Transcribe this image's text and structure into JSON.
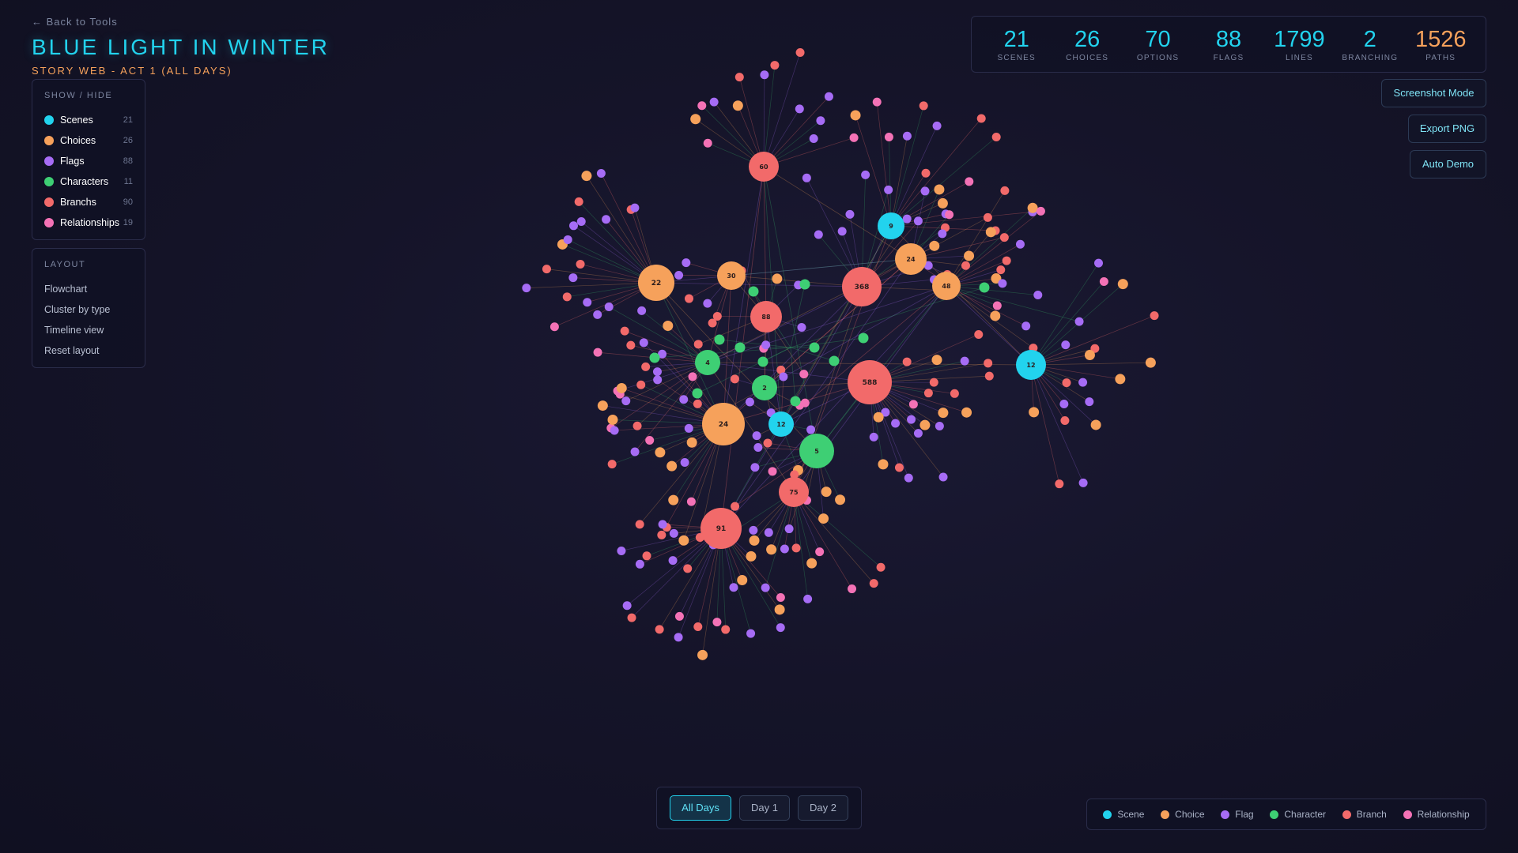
{
  "header": {
    "back_label": "← Back to Tools",
    "title": "BLUE LIGHT IN WINTER",
    "subtitle": "STORY WEB - ACT 1 (ALL DAYS)"
  },
  "colors": {
    "scene": "#22d3ee",
    "choice": "#f6a15b",
    "flag": "#a66cf5",
    "character": "#3ecf74",
    "branch": "#f26a6a",
    "relationship": "#f472b6"
  },
  "show_hide": {
    "heading": "SHOW / HIDE",
    "items": [
      {
        "label": "Scenes",
        "count": "21",
        "color": "#22d3ee"
      },
      {
        "label": "Choices",
        "count": "26",
        "color": "#f6a15b"
      },
      {
        "label": "Flags",
        "count": "88",
        "color": "#a66cf5"
      },
      {
        "label": "Characters",
        "count": "11",
        "color": "#3ecf74"
      },
      {
        "label": "Branchs",
        "count": "90",
        "color": "#f26a6a"
      },
      {
        "label": "Relationships",
        "count": "19",
        "color": "#f472b6"
      }
    ]
  },
  "layout": {
    "heading": "LAYOUT",
    "items": [
      "Flowchart",
      "Cluster by type",
      "Timeline view",
      "Reset layout"
    ]
  },
  "stats": [
    {
      "value": "21",
      "label": "SCENES"
    },
    {
      "value": "26",
      "label": "CHOICES"
    },
    {
      "value": "70",
      "label": "OPTIONS"
    },
    {
      "value": "88",
      "label": "FLAGS"
    },
    {
      "value": "1799",
      "label": "LINES"
    },
    {
      "value": "2",
      "label": "BRANCHING"
    },
    {
      "value": "1526",
      "label": "PATHS"
    }
  ],
  "actions": {
    "screenshot": "Screenshot Mode",
    "export": "Export PNG",
    "demo": "Auto Demo"
  },
  "days": {
    "all": "All Days",
    "day1": "Day 1",
    "day2": "Day 2",
    "active": "All Days"
  },
  "legend": [
    {
      "label": "Scene",
      "color": "#22d3ee"
    },
    {
      "label": "Choice",
      "color": "#f6a15b"
    },
    {
      "label": "Flag",
      "color": "#a66cf5"
    },
    {
      "label": "Character",
      "color": "#3ecf74"
    },
    {
      "label": "Branch",
      "color": "#f26a6a"
    },
    {
      "label": "Relationship",
      "color": "#f472b6"
    }
  ],
  "graph": {
    "hubs": [
      {
        "label": "60",
        "type": "branch"
      },
      {
        "label": "22",
        "type": "choice"
      },
      {
        "label": "30",
        "type": "choice"
      },
      {
        "label": "88",
        "type": "branch"
      },
      {
        "label": "368",
        "type": "branch"
      },
      {
        "label": "9",
        "type": "scene"
      },
      {
        "label": "24",
        "type": "choice"
      },
      {
        "label": "48",
        "type": "choice"
      },
      {
        "label": "12",
        "type": "scene"
      },
      {
        "label": "588",
        "type": "branch"
      },
      {
        "label": "4",
        "type": "character"
      },
      {
        "label": "2",
        "type": "character"
      },
      {
        "label": "24",
        "type": "choice"
      },
      {
        "label": "12",
        "type": "scene"
      },
      {
        "label": "5",
        "type": "character"
      },
      {
        "label": "75",
        "type": "branch"
      },
      {
        "label": "91",
        "type": "branch"
      }
    ]
  }
}
